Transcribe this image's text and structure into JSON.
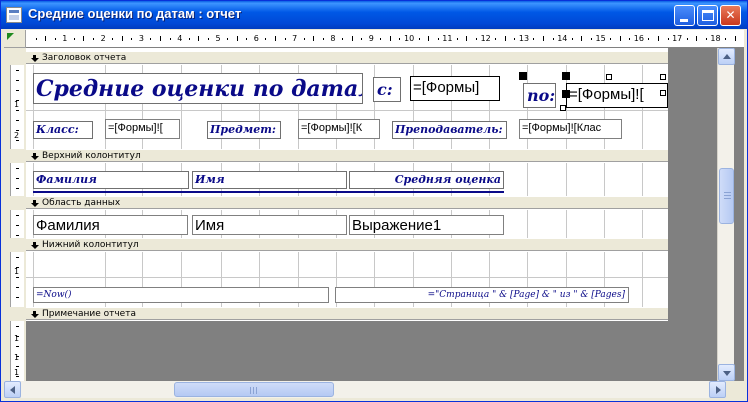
{
  "window": {
    "title": "Средние оценки по датам : отчет"
  },
  "ruler": {
    "labels": [
      "1",
      "2",
      "3",
      "4",
      "5",
      "6",
      "7",
      "8",
      "9",
      "10",
      "11",
      "12",
      "13",
      "14",
      "15",
      "16",
      "17",
      "18"
    ],
    "vertical_labels": [
      "1",
      "2",
      "1",
      "1",
      "1",
      "1",
      "2"
    ]
  },
  "sections": {
    "report_header": "Заголовок отчета",
    "page_header": "Верхний колонтитул",
    "detail": "Область данных",
    "page_footer": "Нижний колонтитул",
    "report_footer": "Примечание отчета"
  },
  "report_header": {
    "title": "Средние оценки по датам",
    "from_label": "с:",
    "from_field": "=[Формы]",
    "to_label": "по:",
    "to_field": "=[Формы]![",
    "class_label": "Класс:",
    "class_field": "=[Формы]![",
    "subject_label": "Предмет:",
    "subject_field": "=[Формы]![К",
    "teacher_label": "Преподаватель:",
    "teacher_field": "=[Формы]![Клас"
  },
  "page_header": {
    "col_surname": "Фамилия",
    "col_name": "Имя",
    "col_avg": "Средняя оценка"
  },
  "detail": {
    "field_surname": "Фамилия",
    "field_name": "Имя",
    "field_expr": "Выражение1"
  },
  "page_footer": {
    "now_expr": "=Now()",
    "page_expr": "=\"Страница \" & [Page] & \" из \" & [Pages]"
  },
  "icons": {
    "section_arrow": "section-expand-arrow-icon",
    "window_icon": "report-icon"
  }
}
